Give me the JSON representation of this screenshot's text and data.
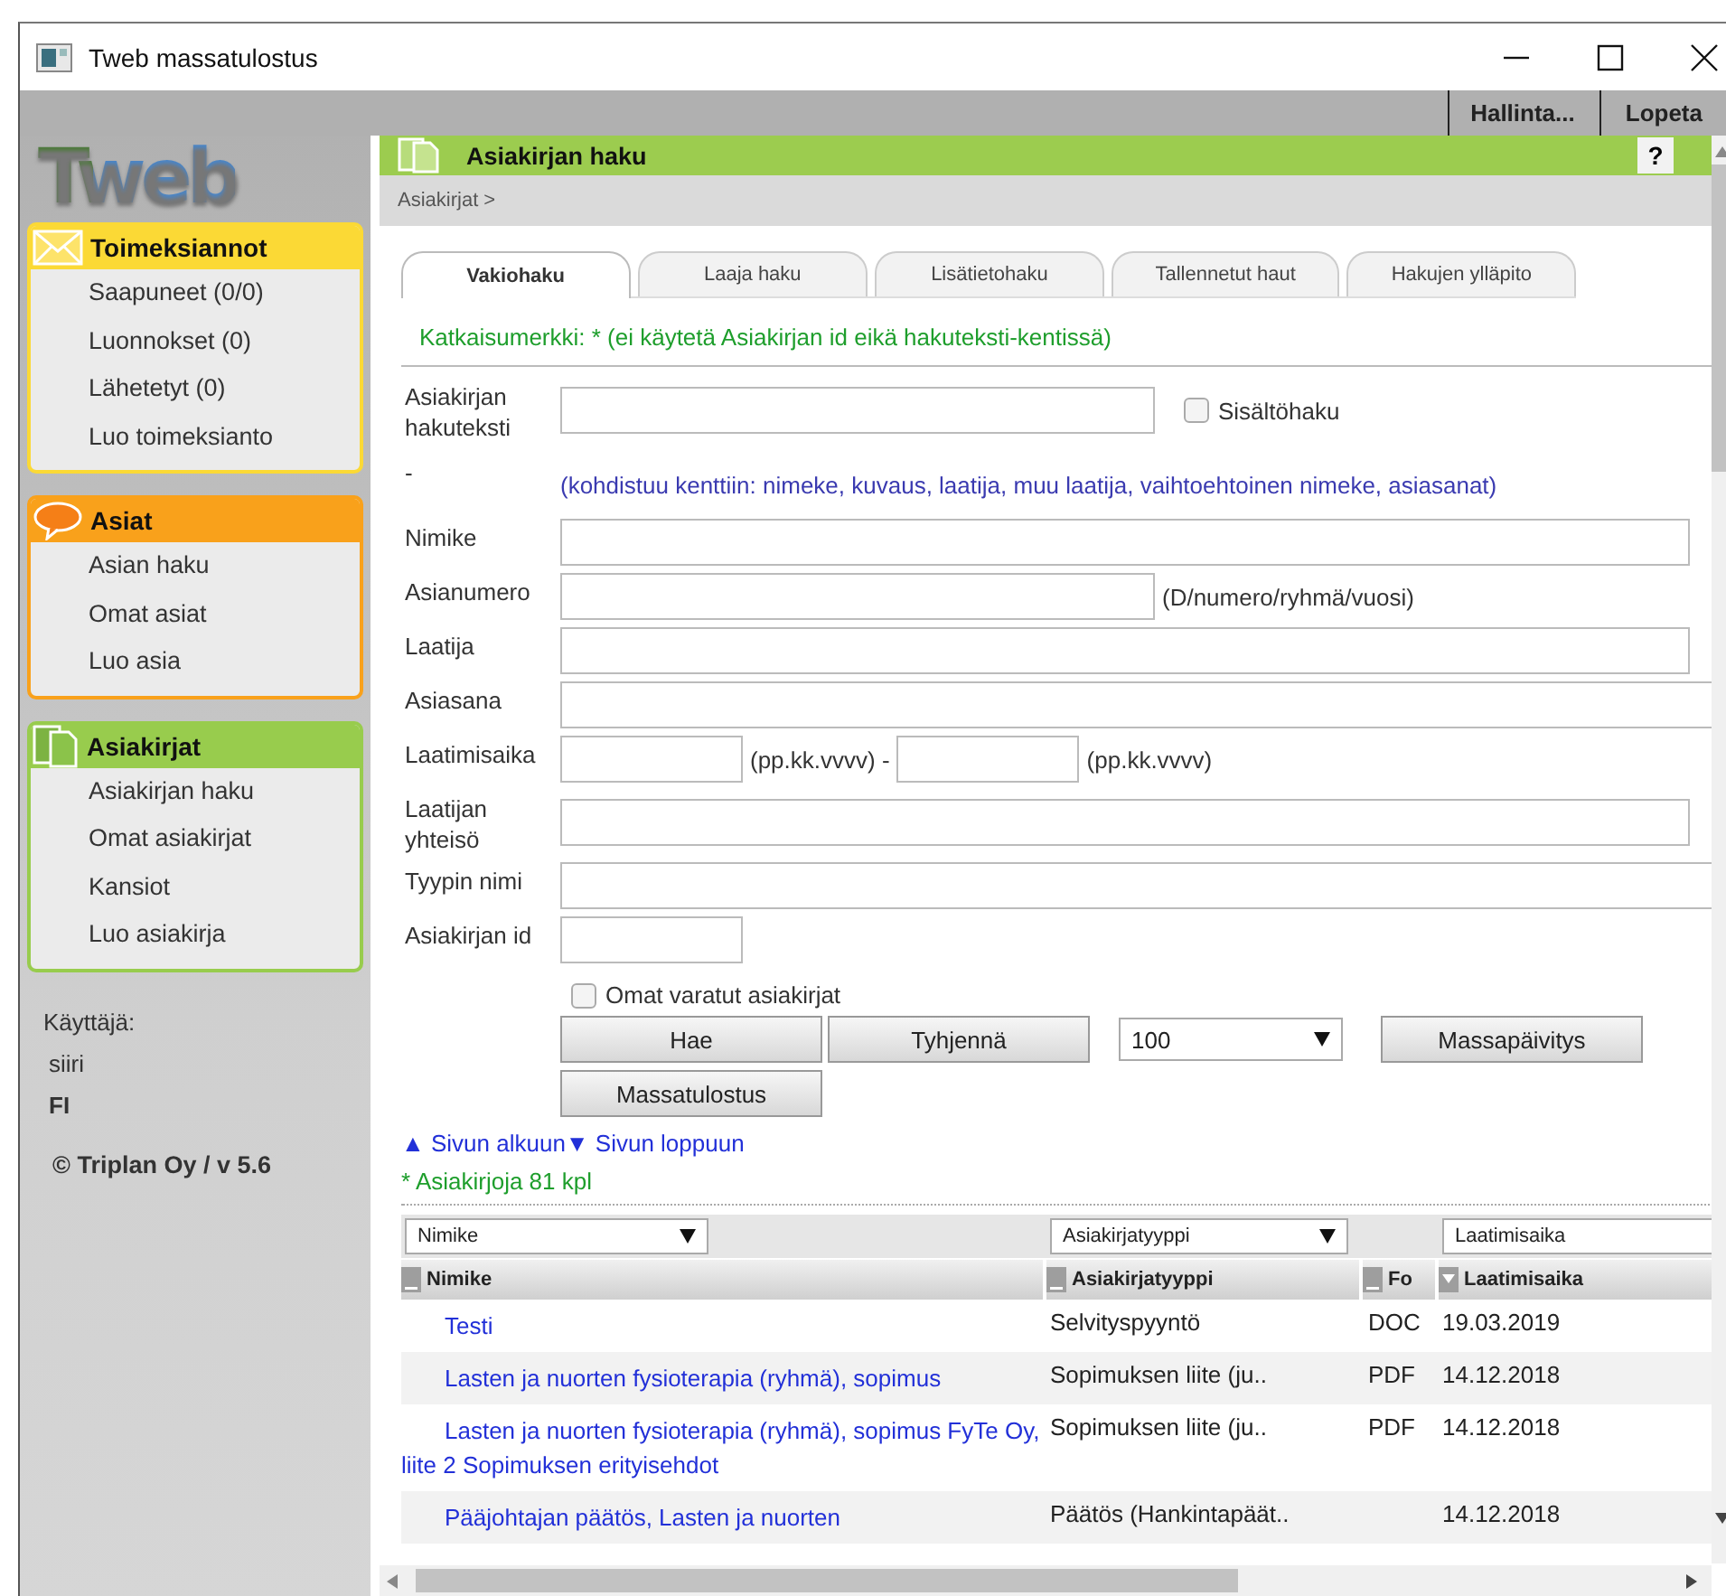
{
  "window": {
    "title": "Tweb massatulostus"
  },
  "top_menu": [
    "Hallinta...",
    "Lopeta"
  ],
  "sidebar": {
    "logo": "Tweb",
    "sections": [
      {
        "title": "Toimeksiannot",
        "kind": "mail",
        "items": [
          "Saapuneet  (0/0)",
          "Luonnokset  (0)",
          "Lähetetyt  (0)",
          "Luo toimeksianto"
        ]
      },
      {
        "title": "Asiat",
        "kind": "case",
        "items": [
          "Asian haku",
          "Omat asiat",
          "Luo asia"
        ]
      },
      {
        "title": "Asiakirjat",
        "kind": "docs",
        "items": [
          "Asiakirjan haku",
          "Omat asiakirjat",
          "Kansiot",
          "Luo asiakirja"
        ]
      }
    ],
    "user_label": "Käyttäjä:",
    "user": "siiri",
    "language": "FI",
    "copyright": "© Triplan Oy / v 5.6"
  },
  "panel": {
    "title": "Asiakirjan haku",
    "help": "?",
    "breadcrumb": "Asiakirjat >"
  },
  "tabs": [
    {
      "label": "Vakiohaku",
      "selected": true
    },
    {
      "label": "Laaja haku",
      "selected": false
    },
    {
      "label": "Lisätietohaku",
      "selected": false
    },
    {
      "label": "Tallennetut haut",
      "selected": false
    },
    {
      "label": "Hakujen ylläpito",
      "selected": false
    }
  ],
  "wildcard_note": "Katkaisumerkki: * (ei käytetä Asiakirjan id eikä hakuteksti-kentissä)",
  "form": [
    {
      "label": "Asiakirjan hakuteksti",
      "kind": "half",
      "checkbox": {
        "label": "Sisältöhaku",
        "checked": false
      }
    },
    {
      "label": "-",
      "kind": "note",
      "note": "(kohdistuu kenttiin: nimeke, kuvaus, laatija, muu laatija, vaihtoehtoinen nimeke, asiasanat)"
    },
    {
      "label": "Nimike",
      "kind": "wide"
    },
    {
      "label": "Asianumero",
      "kind": "half",
      "hints": [
        "(D/numero/ryhmä/vuosi)"
      ]
    },
    {
      "label": "Laatija",
      "kind": "wide"
    },
    {
      "label": "Asiasana",
      "kind": "full"
    },
    {
      "label": "Laatimisaika",
      "kind": "date",
      "hints": [
        "(pp.kk.vvvv) -",
        "(pp.kk.vvvv)"
      ]
    },
    {
      "label": "Laatijan yhteisö",
      "kind": "wide"
    },
    {
      "label": "Tyypin nimi",
      "kind": "full"
    },
    {
      "label": "Asiakirjan id",
      "kind": "small"
    }
  ],
  "own_reserved": {
    "label": "Omat varatut asiakirjat",
    "checked": false
  },
  "action_rows": [
    [
      {
        "kind": "button",
        "label": "Hae"
      },
      {
        "kind": "button",
        "label": "Tyhjennä"
      },
      {
        "kind": "select",
        "value": "100"
      },
      {
        "kind": "button",
        "label": "Massapäivitys"
      }
    ],
    [
      {
        "kind": "button",
        "label": "Massatulostus"
      }
    ]
  ],
  "page_links": [
    "▲ Sivun alkuun",
    "▼ Sivun loppuun"
  ],
  "result_count": "* Asiakirjoja 81 kpl",
  "table": {
    "filters": [
      {
        "kind": "select",
        "value": "Nimike"
      },
      {
        "kind": "select",
        "value": "Asiakirjatyyppi"
      },
      {
        "kind": "empty"
      },
      {
        "kind": "input",
        "value": "Laatimisaika"
      }
    ],
    "columns": [
      {
        "label": "Nimike",
        "sorted": false
      },
      {
        "label": "Asiakirjatyyppi",
        "sorted": false
      },
      {
        "label": "Fo",
        "sorted": false
      },
      {
        "label": "Laatimisaika",
        "sorted": true
      }
    ],
    "rows": [
      {
        "title": "Testi",
        "type": "Selvityspyyntö",
        "format": "DOC",
        "date": "19.03.2019"
      },
      {
        "title": "Lasten ja nuorten fysioterapia (ryhmä), sopimus",
        "type": "Sopimuksen liite (ju..",
        "format": "PDF",
        "date": "14.12.2018"
      },
      {
        "title": "Lasten ja nuorten fysioterapia (ryhmä), sopimus FyTe Oy, liite 2 Sopimuksen erityisehdot",
        "type": "Sopimuksen liite (ju..",
        "format": "PDF",
        "date": "14.12.2018"
      },
      {
        "title": "Pääjohtajan päätös, Lasten ja nuorten",
        "type": "Päätös (Hankintapäät..",
        "date": "14.12.2018"
      }
    ]
  }
}
